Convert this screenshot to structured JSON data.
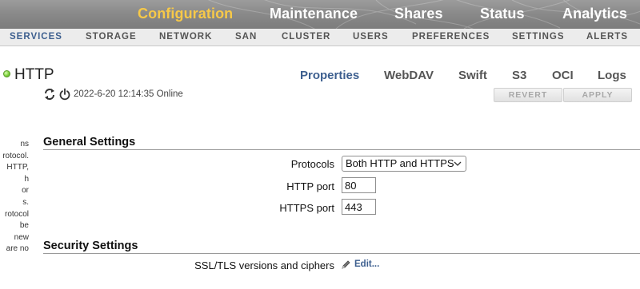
{
  "top_nav": {
    "items": [
      {
        "label": "Configuration",
        "active": true
      },
      {
        "label": "Maintenance",
        "active": false
      },
      {
        "label": "Shares",
        "active": false
      },
      {
        "label": "Status",
        "active": false
      },
      {
        "label": "Analytics",
        "active": false
      }
    ]
  },
  "sub_nav": {
    "items": [
      {
        "label": "SERVICES",
        "active": true
      },
      {
        "label": "STORAGE",
        "active": false
      },
      {
        "label": "NETWORK",
        "active": false
      },
      {
        "label": "SAN",
        "active": false
      },
      {
        "label": "CLUSTER",
        "active": false
      },
      {
        "label": "USERS",
        "active": false
      },
      {
        "label": "PREFERENCES",
        "active": false
      },
      {
        "label": "SETTINGS",
        "active": false
      },
      {
        "label": "ALERTS",
        "active": false
      }
    ]
  },
  "left_panel": {
    "lines": [
      "ns",
      "rotocol.",
      "HTTP,",
      "h",
      "or",
      "s.",
      "rotocol",
      "be",
      "new",
      "are no"
    ]
  },
  "service": {
    "title": "HTTP",
    "status_color": "#7ccf3a",
    "status_text": "2022-6-20 12:14:35 Online",
    "icons": [
      "restart-icon",
      "power-icon"
    ]
  },
  "tabs": [
    {
      "label": "Properties",
      "active": true
    },
    {
      "label": "WebDAV",
      "active": false
    },
    {
      "label": "Swift",
      "active": false
    },
    {
      "label": "S3",
      "active": false
    },
    {
      "label": "OCI",
      "active": false
    },
    {
      "label": "Logs",
      "active": false
    }
  ],
  "actions": {
    "revert_label": "REVERT",
    "apply_label": "APPLY"
  },
  "general": {
    "title": "General Settings",
    "protocols_label": "Protocols",
    "protocols_value": "Both HTTP and HTTPS",
    "http_port_label": "HTTP port",
    "http_port_value": "80",
    "https_port_label": "HTTPS port",
    "https_port_value": "443"
  },
  "security": {
    "title": "Security Settings",
    "ssl_label": "SSL/TLS versions and ciphers",
    "edit_label": "Edit..."
  },
  "colors": {
    "active_top": "#f7c948",
    "accent": "#3d5f8f"
  }
}
